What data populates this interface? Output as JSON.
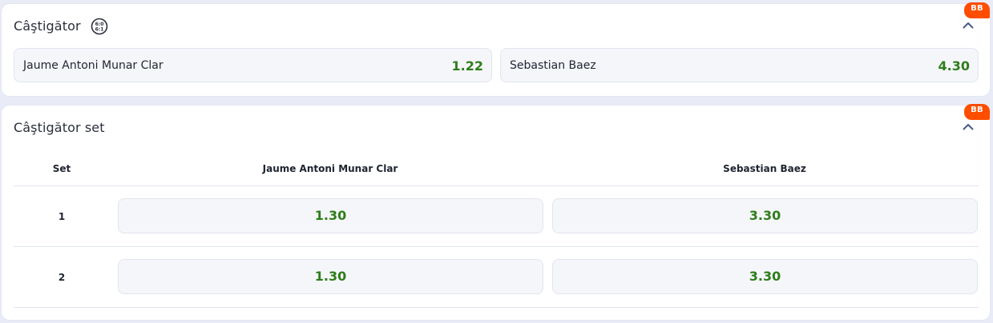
{
  "winner": {
    "title": "Câştigător",
    "badge": "BB",
    "icon": "score-board-icon",
    "chevron": "chevron-up-icon",
    "outcomes": [
      {
        "name": "Jaume Antoni Munar Clar",
        "price": "1.22"
      },
      {
        "name": "Sebastian Baez",
        "price": "4.30"
      }
    ]
  },
  "set_winner": {
    "title": "Câştigător set",
    "badge": "BB",
    "chevron": "chevron-up-icon",
    "columns": [
      "Set",
      "Jaume Antoni Munar Clar",
      "Sebastian Baez"
    ],
    "rows": [
      {
        "set": "1",
        "p1": "1.30",
        "p2": "3.30"
      },
      {
        "set": "2",
        "p1": "1.30",
        "p2": "3.30"
      }
    ]
  },
  "colors": {
    "background": "#e9ecf6",
    "card": "#ffffff",
    "odds_green": "#2e7d1a",
    "badge_orange": "#ff4d00",
    "chevron": "#4a5a8a"
  }
}
